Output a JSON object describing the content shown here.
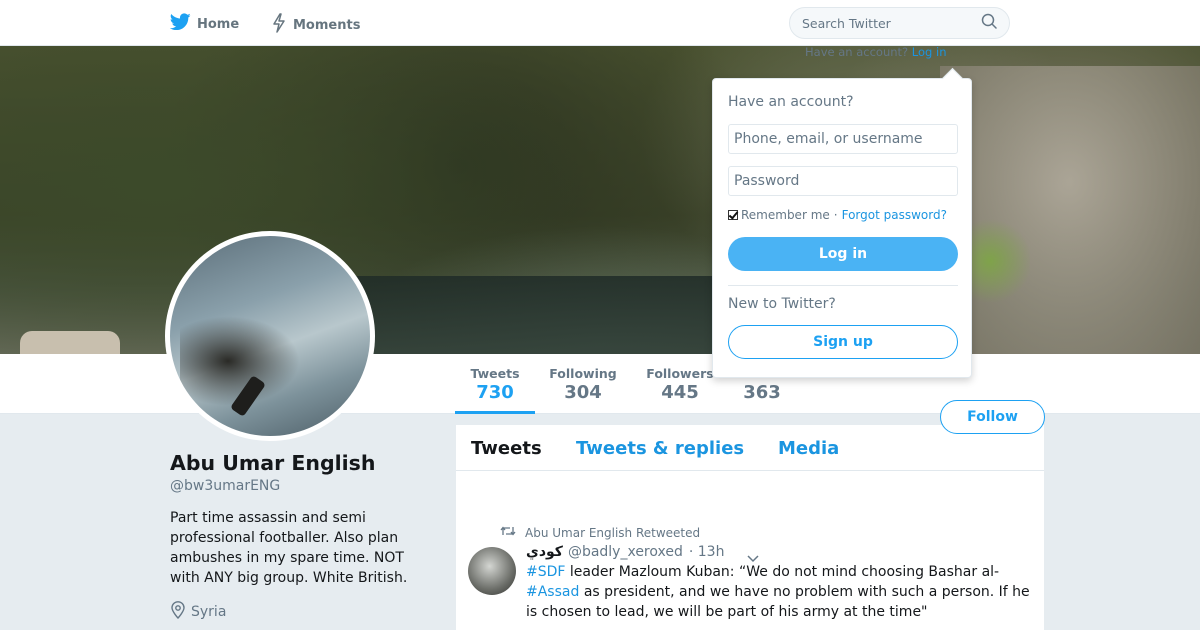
{
  "nav": {
    "home_label": "Home",
    "moments_label": "Moments",
    "search_placeholder": "Search Twitter",
    "account_hint": "Have an account?",
    "login_link": "Log in"
  },
  "profile": {
    "name": "Abu Umar English",
    "handle": "@bw3umarENG",
    "bio": "Part time assassin and semi professional footballer. Also plan ambushes in my spare time. NOT with ANY big group. White British.",
    "location": "Syria",
    "follow_label": "Follow"
  },
  "stats": [
    {
      "label": "Tweets",
      "value": "730"
    },
    {
      "label": "Following",
      "value": "304"
    },
    {
      "label": "Followers",
      "value": "445"
    },
    {
      "label": "",
      "value": "363"
    }
  ],
  "timeline": {
    "tabs": [
      "Tweets",
      "Tweets & replies",
      "Media"
    ],
    "tweet": {
      "retweet_label": "Abu Umar English Retweeted",
      "author_name": "كودي",
      "author_handle": "@badly_xeroxed",
      "time": "· 13h",
      "text_parts": [
        "#SDF",
        " leader Mazloum Kuban: “We do not mind choosing Bashar al-",
        "#Assad",
        " as president, and we have no problem with such a person. If he is chosen to lead, we will be part of his army at the time\""
      ]
    }
  },
  "login": {
    "heading": "Have an account?",
    "username_placeholder": "Phone, email, or username",
    "password_placeholder": "Password",
    "remember_label": "Remember me",
    "separator": "·",
    "forgot_label": "Forgot password?",
    "login_button": "Log in",
    "new_label": "New to Twitter?",
    "signup_button": "Sign up"
  },
  "colors": {
    "accent": "#1da1f2",
    "link": "#1b95e0",
    "login_button_bg": "#4ab3f4",
    "page_bg": "#e6ecf0"
  },
  "icons": [
    "twitter-bird-icon",
    "lightning-icon",
    "search-icon",
    "location-pin-icon",
    "retweet-icon",
    "chevron-down-icon"
  ]
}
